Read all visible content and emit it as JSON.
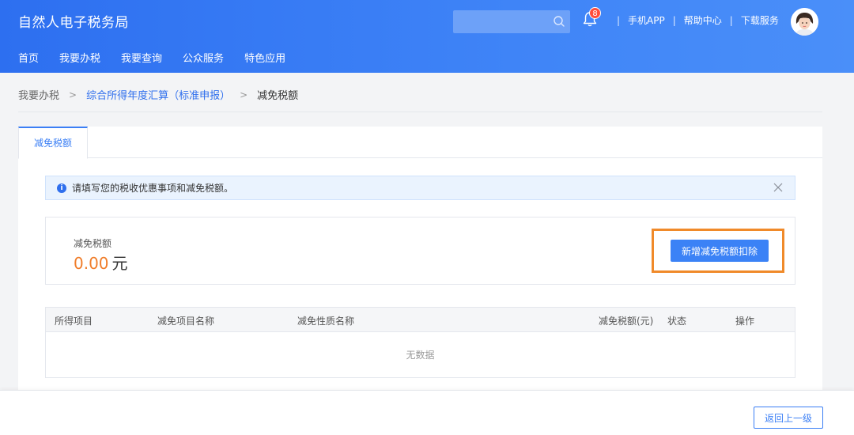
{
  "header": {
    "title": "自然人电子税务局",
    "search_placeholder": "",
    "notification_count": "8",
    "links": [
      "手机APP",
      "帮助中心",
      "下载服务"
    ],
    "link_separator": "|"
  },
  "nav": {
    "items": [
      "首页",
      "我要办税",
      "我要查询",
      "公众服务",
      "特色应用"
    ]
  },
  "breadcrumb": {
    "items": [
      "我要办税",
      "综合所得年度汇算（标准申报）",
      "减免税额"
    ],
    "separator": ">"
  },
  "tabs": [
    "减免税额"
  ],
  "notice": {
    "text": "请填写您的税收优惠事项和减免税额。"
  },
  "summary": {
    "label": "减免税额",
    "amount": "0.00",
    "unit": "元",
    "add_button": "新增减免税额扣除"
  },
  "table": {
    "columns": [
      "所得项目",
      "减免项目名称",
      "减免性质名称",
      "减免税额(元)",
      "状态",
      "操作"
    ],
    "empty_text": "无数据"
  },
  "footer": {
    "back_button": "返回上一级"
  },
  "colors": {
    "header_blue": "#2d6ff0",
    "accent_blue": "#3b7ff5",
    "amount_orange": "#f07d2a",
    "highlight_orange": "#f08a2a",
    "badge_red": "#ff4d3b"
  }
}
